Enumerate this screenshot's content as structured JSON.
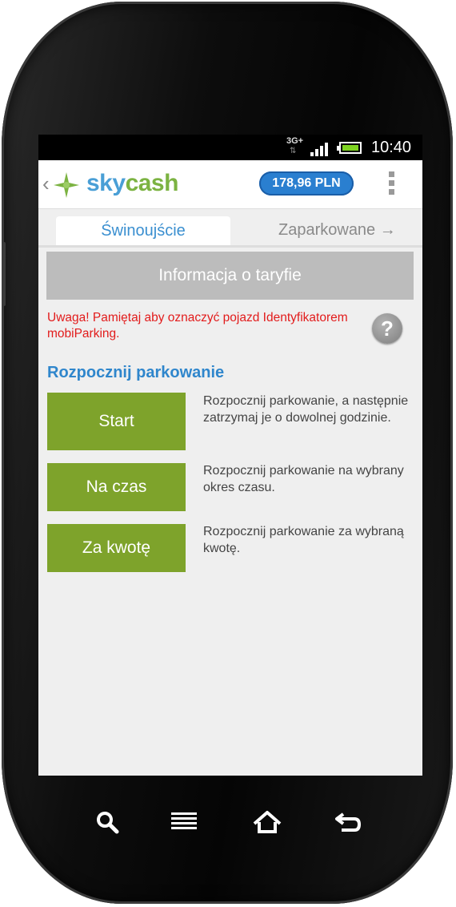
{
  "status_bar": {
    "network": "3G+",
    "network_arrows": "⇅",
    "time": "10:40"
  },
  "app_bar": {
    "back_chevron": "‹",
    "logo_sky": "sky",
    "logo_cash": "cash",
    "balance": "178,96 PLN"
  },
  "tabs": {
    "active": "Świnoujście",
    "next": "Zaparkowane →"
  },
  "info_button": "Informacja o taryfie",
  "warning": "Uwaga! Pamiętaj aby oznaczyć pojazd Identyfikatorem mobiParking.",
  "help_icon_label": "?",
  "section_title": "Rozpocznij parkowanie",
  "actions": [
    {
      "label": "Start",
      "description": "Rozpocznij parkowanie, a następnie zatrzymaj je o dowolnej godzinie."
    },
    {
      "label": "Na czas",
      "description": "Rozpocznij parkowanie na wybrany okres czasu."
    },
    {
      "label": "Za kwotę",
      "description": "Rozpocznij parkowanie za wybraną kwotę."
    }
  ],
  "icons": {
    "logo": "skycash-star-icon",
    "overflow": "overflow-menu-icon",
    "nav": [
      "search-icon",
      "menu-icon",
      "home-icon",
      "back-icon"
    ]
  },
  "colors": {
    "accent_green": "#7ea32b",
    "brand_blue": "#2a7fd0",
    "warning_red": "#e21b1b",
    "title_blue": "#2f86cc"
  }
}
